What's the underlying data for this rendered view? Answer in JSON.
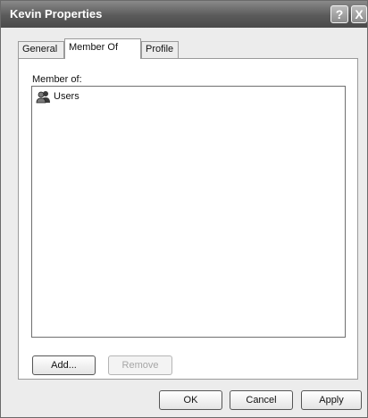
{
  "window": {
    "title": "Kevin Properties",
    "help_label": "?",
    "close_label": "X"
  },
  "tabs": [
    {
      "label": "General",
      "selected": false
    },
    {
      "label": "Member Of",
      "selected": true
    },
    {
      "label": "Profile",
      "selected": false
    }
  ],
  "member_of": {
    "label": "Member of:",
    "items": [
      {
        "name": "Users",
        "icon": "user-group-icon"
      }
    ]
  },
  "buttons": {
    "add": "Add...",
    "remove": "Remove",
    "ok": "OK",
    "cancel": "Cancel",
    "apply": "Apply"
  }
}
